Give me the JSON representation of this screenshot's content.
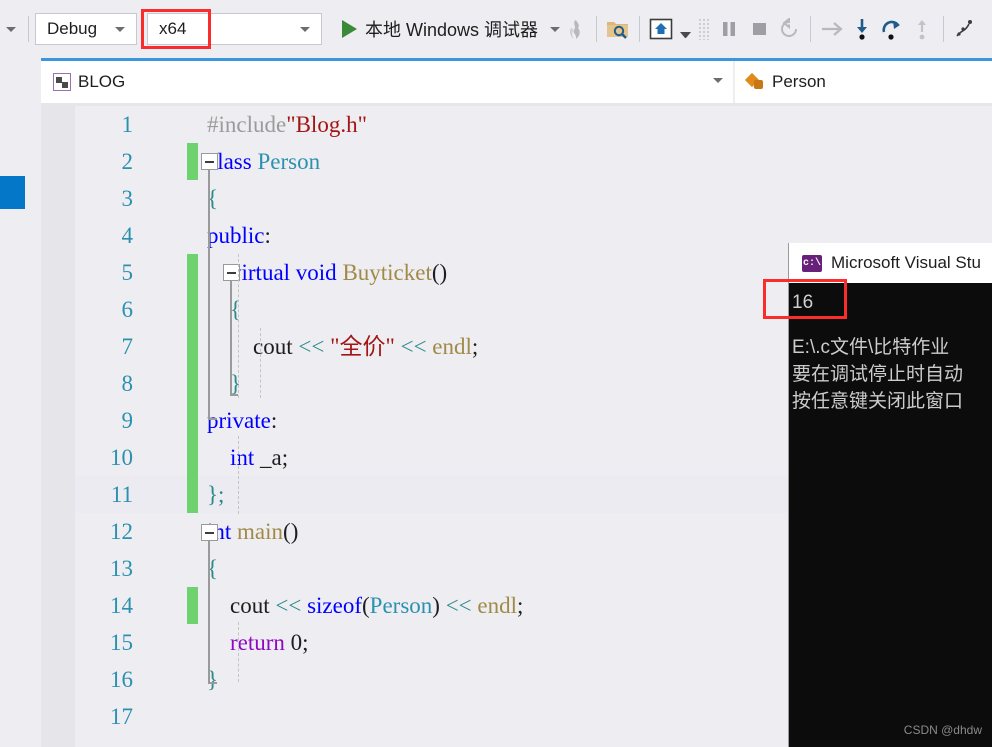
{
  "toolbar": {
    "configuration_combo": {
      "value": "Debug",
      "icon": "chevron-down-icon"
    },
    "platform_combo": {
      "value": "x64",
      "icon": "chevron-down-icon"
    },
    "run_button_label": "本地 Windows 调试器",
    "icons": [
      "overflow-chevron-icon",
      "hot-reload-icon",
      "search-folder-icon",
      "home-frame-icon",
      "dropdown-small-icon",
      "grip-dots-icon",
      "pause-icon",
      "stop-icon",
      "restart-icon",
      "show-next-statement-icon",
      "step-into-icon",
      "step-over-icon",
      "step-out-icon",
      "threads-icon"
    ]
  },
  "tabs": {
    "document_tab": {
      "label": "BLOG",
      "icon": "blog-file-icon"
    },
    "member_tab": {
      "label": "Person",
      "icon": "class-member-icon"
    },
    "dropdown_icon": "chevron-down-icon"
  },
  "editor": {
    "lines": [
      {
        "n": "1",
        "changed": false,
        "highlight": false,
        "tokens": [
          {
            "t": "#include",
            "c": "t-pre"
          },
          {
            "t": "\"Blog.h\"",
            "c": "t-str"
          }
        ]
      },
      {
        "n": "2",
        "changed": true,
        "highlight": false,
        "tokens": [
          {
            "t": "class ",
            "c": "t-kw"
          },
          {
            "t": "Person",
            "c": "t-type"
          }
        ]
      },
      {
        "n": "3",
        "changed": false,
        "highlight": false,
        "tokens": [
          {
            "t": "{",
            "c": "t-op"
          }
        ]
      },
      {
        "n": "4",
        "changed": false,
        "highlight": false,
        "tokens": [
          {
            "t": "public",
            "c": "t-kw"
          },
          {
            "t": ":",
            "c": "t-id"
          }
        ]
      },
      {
        "n": "5",
        "changed": true,
        "highlight": false,
        "tokens": [
          {
            "t": "    ",
            "c": "t-id"
          },
          {
            "t": "virtual ",
            "c": "t-kw"
          },
          {
            "t": "void ",
            "c": "t-kw"
          },
          {
            "t": "Buyticket",
            "c": "t-fn"
          },
          {
            "t": "()",
            "c": "t-id"
          }
        ]
      },
      {
        "n": "6",
        "changed": true,
        "highlight": false,
        "tokens": [
          {
            "t": "    ",
            "c": "t-id"
          },
          {
            "t": "{",
            "c": "t-op"
          }
        ]
      },
      {
        "n": "7",
        "changed": true,
        "highlight": false,
        "tokens": [
          {
            "t": "        ",
            "c": "t-id"
          },
          {
            "t": "cout ",
            "c": "t-id"
          },
          {
            "t": "<< ",
            "c": "t-op"
          },
          {
            "t": "\"全价\"",
            "c": "t-str"
          },
          {
            "t": " << ",
            "c": "t-op"
          },
          {
            "t": "endl",
            "c": "t-fn"
          },
          {
            "t": ";",
            "c": "t-id"
          }
        ]
      },
      {
        "n": "8",
        "changed": true,
        "highlight": false,
        "tokens": [
          {
            "t": "    ",
            "c": "t-id"
          },
          {
            "t": "}",
            "c": "t-op"
          }
        ]
      },
      {
        "n": "9",
        "changed": true,
        "highlight": false,
        "tokens": [
          {
            "t": "private",
            "c": "t-kw"
          },
          {
            "t": ":",
            "c": "t-id"
          }
        ]
      },
      {
        "n": "10",
        "changed": true,
        "highlight": false,
        "tokens": [
          {
            "t": "    ",
            "c": "t-id"
          },
          {
            "t": "int ",
            "c": "t-kw"
          },
          {
            "t": "_a;",
            "c": "t-id"
          }
        ]
      },
      {
        "n": "11",
        "changed": true,
        "highlight": true,
        "tokens": [
          {
            "t": "};",
            "c": "t-op"
          }
        ]
      },
      {
        "n": "12",
        "changed": false,
        "highlight": false,
        "tokens": [
          {
            "t": "int ",
            "c": "t-kw"
          },
          {
            "t": "main",
            "c": "t-fn"
          },
          {
            "t": "()",
            "c": "t-id"
          }
        ]
      },
      {
        "n": "13",
        "changed": false,
        "highlight": false,
        "tokens": [
          {
            "t": "{",
            "c": "t-op"
          }
        ]
      },
      {
        "n": "14",
        "changed": true,
        "highlight": false,
        "tokens": [
          {
            "t": "    ",
            "c": "t-id"
          },
          {
            "t": "cout ",
            "c": "t-id"
          },
          {
            "t": "<< ",
            "c": "t-op"
          },
          {
            "t": "sizeof",
            "c": "t-kw"
          },
          {
            "t": "(",
            "c": "t-id"
          },
          {
            "t": "Person",
            "c": "t-type"
          },
          {
            "t": ") ",
            "c": "t-id"
          },
          {
            "t": "<< ",
            "c": "t-op"
          },
          {
            "t": "endl",
            "c": "t-fn"
          },
          {
            "t": ";",
            "c": "t-id"
          }
        ]
      },
      {
        "n": "15",
        "changed": false,
        "highlight": false,
        "tokens": [
          {
            "t": "    ",
            "c": "t-id"
          },
          {
            "t": "return ",
            "c": "t-ctl"
          },
          {
            "t": "0;",
            "c": "t-num"
          }
        ]
      },
      {
        "n": "16",
        "changed": false,
        "highlight": false,
        "tokens": [
          {
            "t": "}",
            "c": "t-op"
          }
        ]
      },
      {
        "n": "17",
        "changed": false,
        "highlight": false,
        "tokens": []
      }
    ]
  },
  "console": {
    "title": "Microsoft Visual Stu",
    "icon": "command-prompt-icon",
    "output_value": "16",
    "lines": [
      "E:\\.c文件\\比特作业",
      "要在调试停止时自动",
      "按任意键关闭此窗口"
    ]
  },
  "annotations": {
    "platform_highlight_color": "#fb2c2c",
    "console_highlight_color": "#fb2c2c"
  },
  "watermark": "CSDN @dhdw"
}
